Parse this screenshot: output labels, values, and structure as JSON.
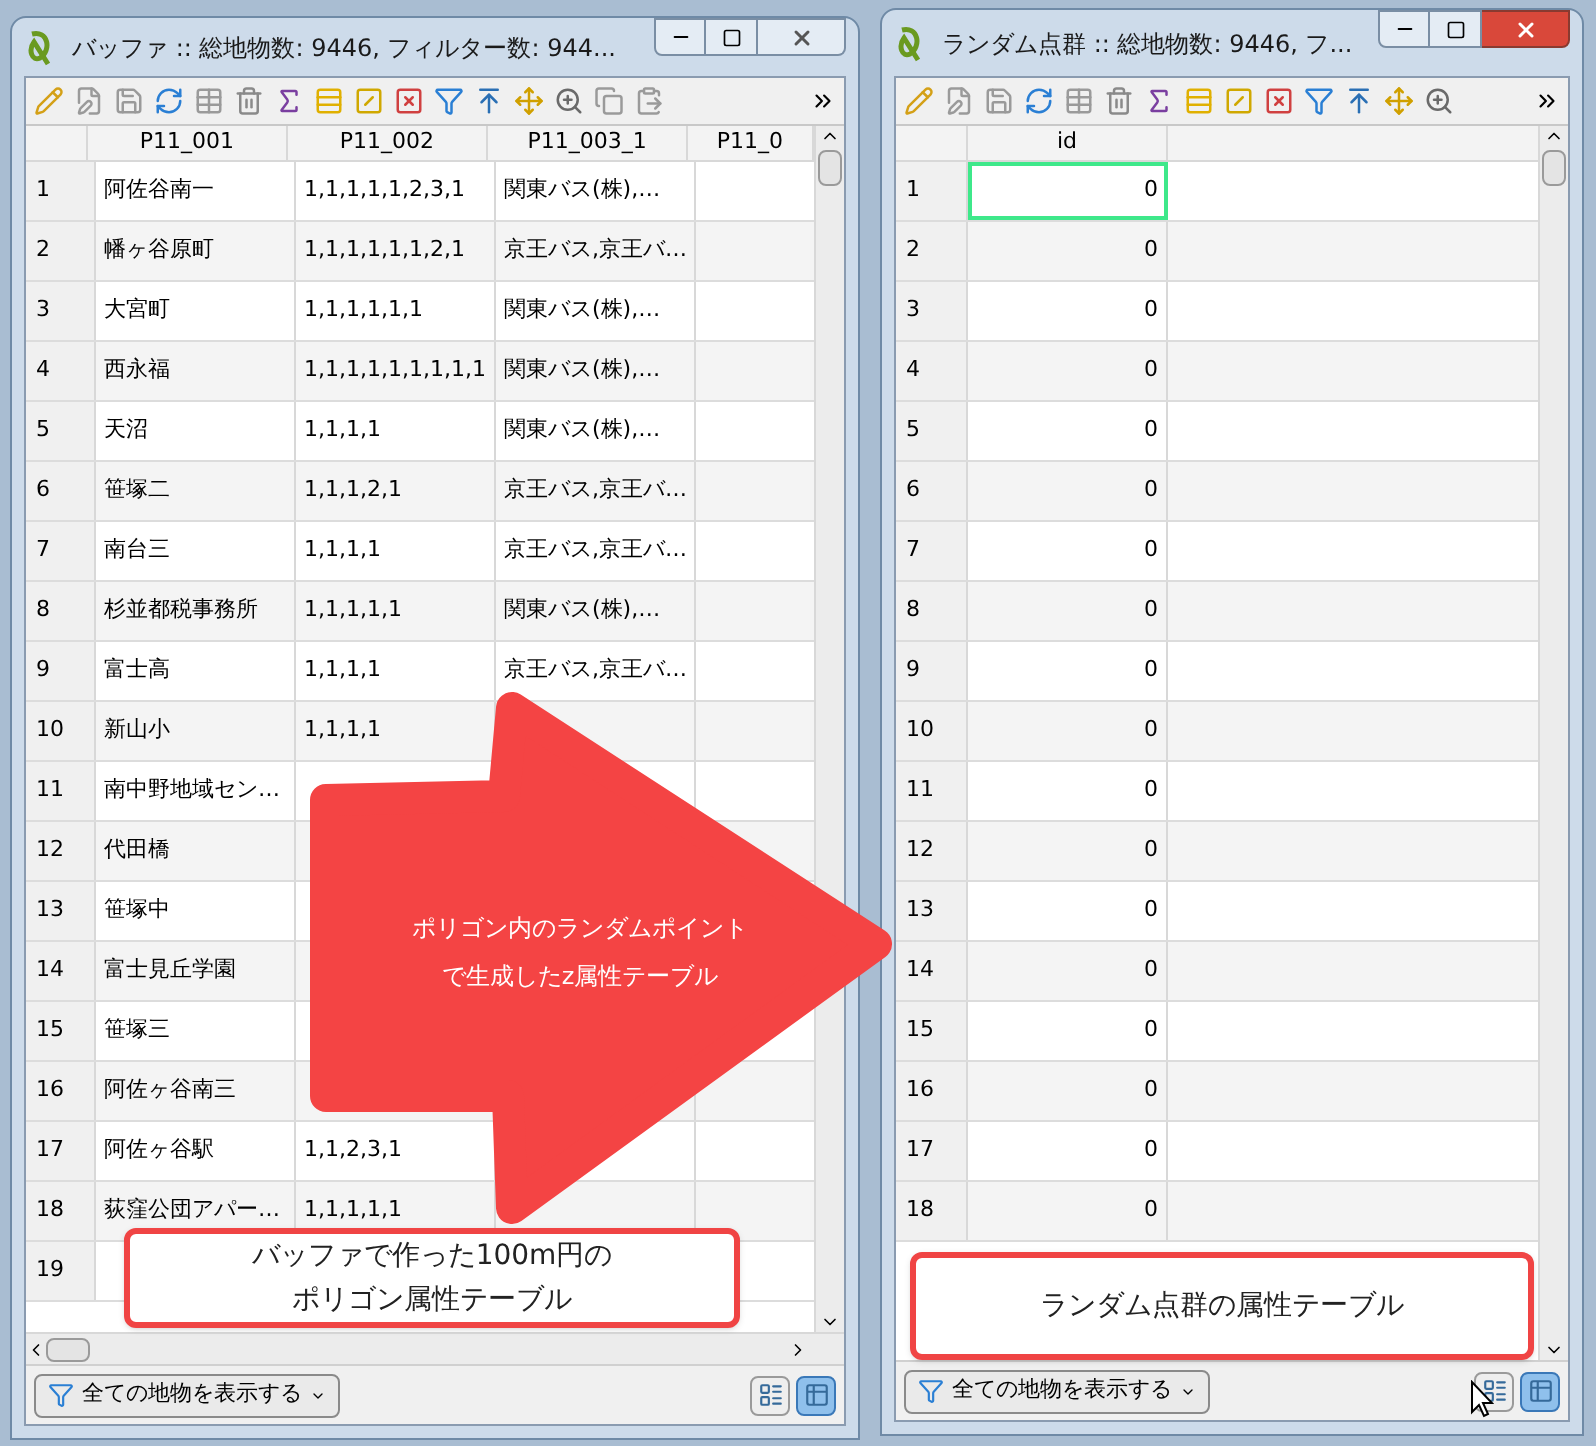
{
  "windows": [
    {
      "title": "バッファ :: 総地物数: 9446, フィルター数: 944...",
      "active": false,
      "columns": [
        "P11_001",
        "P11_002",
        "P11_003_1",
        "P11_0"
      ],
      "rows": [
        {
          "number": "1",
          "cells": [
            "阿佐谷南一",
            "1,1,1,1,1,2,3,1",
            "関東バス(株),…"
          ]
        },
        {
          "number": "2",
          "cells": [
            "幡ヶ谷原町",
            "1,1,1,1,1,1,2,1",
            "京王バス,京王バ…"
          ]
        },
        {
          "number": "3",
          "cells": [
            "大宮町",
            "1,1,1,1,1,1",
            "関東バス(株),…"
          ]
        },
        {
          "number": "4",
          "cells": [
            "西永福",
            "1,1,1,1,1,1,1,1,1",
            "関東バス(株),…"
          ]
        },
        {
          "number": "5",
          "cells": [
            "天沼",
            "1,1,1,1",
            "関東バス(株),…"
          ]
        },
        {
          "number": "6",
          "cells": [
            "笹塚二",
            "1,1,1,2,1",
            "京王バス,京王バ…"
          ]
        },
        {
          "number": "7",
          "cells": [
            "南台三",
            "1,1,1,1",
            "京王バス,京王バ…"
          ]
        },
        {
          "number": "8",
          "cells": [
            "杉並都税事務所",
            "1,1,1,1,1",
            "関東バス(株),…"
          ]
        },
        {
          "number": "9",
          "cells": [
            "富士高",
            "1,1,1,1",
            "京王バス,京王バ…"
          ]
        },
        {
          "number": "10",
          "cells": [
            "新山小",
            "1,1,1,1",
            null
          ]
        },
        {
          "number": "11",
          "cells": [
            "南中野地域セン…",
            null,
            null
          ]
        },
        {
          "number": "12",
          "cells": [
            "代田橋",
            null,
            null
          ]
        },
        {
          "number": "13",
          "cells": [
            "笹塚中",
            null,
            null
          ]
        },
        {
          "number": "14",
          "cells": [
            "富士見丘学園",
            null,
            null
          ]
        },
        {
          "number": "15",
          "cells": [
            "笹塚三",
            null,
            null
          ]
        },
        {
          "number": "16",
          "cells": [
            "阿佐ヶ谷南三",
            null,
            null
          ]
        },
        {
          "number": "17",
          "cells": [
            "阿佐ヶ谷駅",
            "1,1,2,3,1",
            null
          ]
        },
        {
          "number": "18",
          "cells": [
            "荻窪公団アパー…",
            "1,1,1,1,1",
            null
          ]
        },
        {
          "number": "19",
          "cells": [
            null,
            null,
            null
          ]
        }
      ],
      "filter_button": "全ての地物を表示する",
      "views": [
        {
          "selected": false
        },
        {
          "selected": true
        }
      ]
    },
    {
      "title": "ランダム点群 :: 総地物数: 9446, フ...",
      "active": true,
      "columns": [
        "id"
      ],
      "rows": [
        {
          "number": "1",
          "cells": [
            "0"
          ],
          "selected": true
        },
        {
          "number": "2",
          "cells": [
            "0"
          ],
          "selected": false
        },
        {
          "number": "3",
          "cells": [
            "0"
          ],
          "selected": false
        },
        {
          "number": "4",
          "cells": [
            "0"
          ],
          "selected": false
        },
        {
          "number": "5",
          "cells": [
            "0"
          ],
          "selected": false
        },
        {
          "number": "6",
          "cells": [
            "0"
          ],
          "selected": false
        },
        {
          "number": "7",
          "cells": [
            "0"
          ],
          "selected": false
        },
        {
          "number": "8",
          "cells": [
            "0"
          ],
          "selected": false
        },
        {
          "number": "9",
          "cells": [
            "0"
          ],
          "selected": false
        },
        {
          "number": "10",
          "cells": [
            "0"
          ],
          "selected": false
        },
        {
          "number": "11",
          "cells": [
            "0"
          ],
          "selected": false
        },
        {
          "number": "12",
          "cells": [
            "0"
          ],
          "selected": false
        },
        {
          "number": "13",
          "cells": [
            "0"
          ],
          "selected": false
        },
        {
          "number": "14",
          "cells": [
            "0"
          ],
          "selected": false
        },
        {
          "number": "15",
          "cells": [
            "0"
          ],
          "selected": false
        },
        {
          "number": "16",
          "cells": [
            "0"
          ],
          "selected": false
        },
        {
          "number": "17",
          "cells": [
            "0"
          ],
          "selected": false
        },
        {
          "number": "18",
          "cells": [
            "0"
          ],
          "selected": false
        }
      ],
      "filter_button": "全ての地物を表示する",
      "views": [
        {
          "selected": false
        },
        {
          "selected": true
        }
      ]
    }
  ],
  "arrow": {
    "lines": [
      "ポリゴン内のランダムポイント",
      "で生成したz属性テーブル"
    ]
  },
  "callouts": [
    {
      "lines": [
        "バッファで作った100m円の",
        "ポリゴン属性テーブル"
      ]
    },
    {
      "lines": [
        "ランダム点群の属性テーブル"
      ]
    }
  ]
}
